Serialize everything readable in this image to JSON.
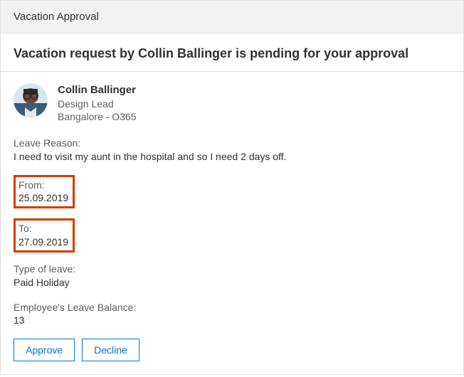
{
  "header": {
    "title": "Vacation Approval",
    "subtitle": "Vacation request by Collin Ballinger is pending for your approval"
  },
  "requester": {
    "name": "Collin Ballinger",
    "role": "Design Lead",
    "location": "Bangalore - O365"
  },
  "reason": {
    "label": "Leave Reason:",
    "value": "I need to visit my aunt in the hospital and so I need 2 days off."
  },
  "from": {
    "label": "From:",
    "value": "25.09.2019"
  },
  "to": {
    "label": "To:",
    "value": "27.09.2019"
  },
  "leave_type": {
    "label": "Type of leave:",
    "value": "Paid Holiday"
  },
  "balance": {
    "label": "Employee's Leave Balance:",
    "value": "13"
  },
  "actions": {
    "approve": "Approve",
    "decline": "Decline"
  }
}
